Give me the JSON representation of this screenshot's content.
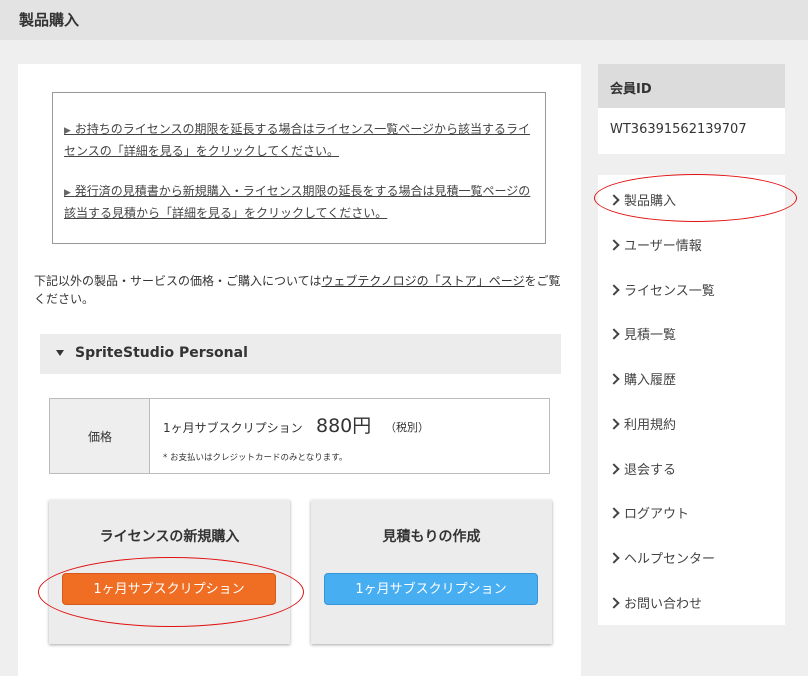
{
  "header": {
    "title": "製品購入"
  },
  "notice": {
    "line1": "お持ちのライセンスの期限を延長する場合はライセンス一覧ページから該当するライセンスの「詳細を見る」をクリックしてください。",
    "line2": "発行済の見積書から新規購入・ライセンス期限の延長をする場合は見積一覧ページの該当する見積から「詳細を見る」をクリックしてください。"
  },
  "intro": {
    "text_before": "下記以外の製品・サービスの価格・ご購入については",
    "link": "ウェブテクノロジの「ストア」ページ",
    "text_after": "をご覧ください。"
  },
  "product": {
    "name": "SpriteStudio Personal"
  },
  "price": {
    "header": "価格",
    "plan": "1ヶ月サブスクリプション",
    "amount": "880円",
    "tax": "（税別）",
    "note": "* お支払いはクレジットカードのみとなります。"
  },
  "cards": {
    "new_purchase": {
      "title": "ライセンスの新規購入",
      "button": "1ヶ月サブスクリプション"
    },
    "estimate": {
      "title": "見積もりの作成",
      "button": "1ヶ月サブスクリプション"
    }
  },
  "member": {
    "label": "会員ID",
    "id": "WT36391562139707"
  },
  "menu": {
    "items": [
      {
        "label": "製品購入"
      },
      {
        "label": "ユーザー情報"
      },
      {
        "label": "ライセンス一覧"
      },
      {
        "label": "見積一覧"
      },
      {
        "label": "購入履歴"
      },
      {
        "label": "利用規約"
      },
      {
        "label": "退会する"
      },
      {
        "label": "ログアウト"
      },
      {
        "label": "ヘルプセンター"
      },
      {
        "label": "お問い合わせ"
      }
    ]
  },
  "colors": {
    "new_purchase_button": "#ef6e23",
    "estimate_button": "#47aef2",
    "annotation_oval": "#e01010"
  }
}
